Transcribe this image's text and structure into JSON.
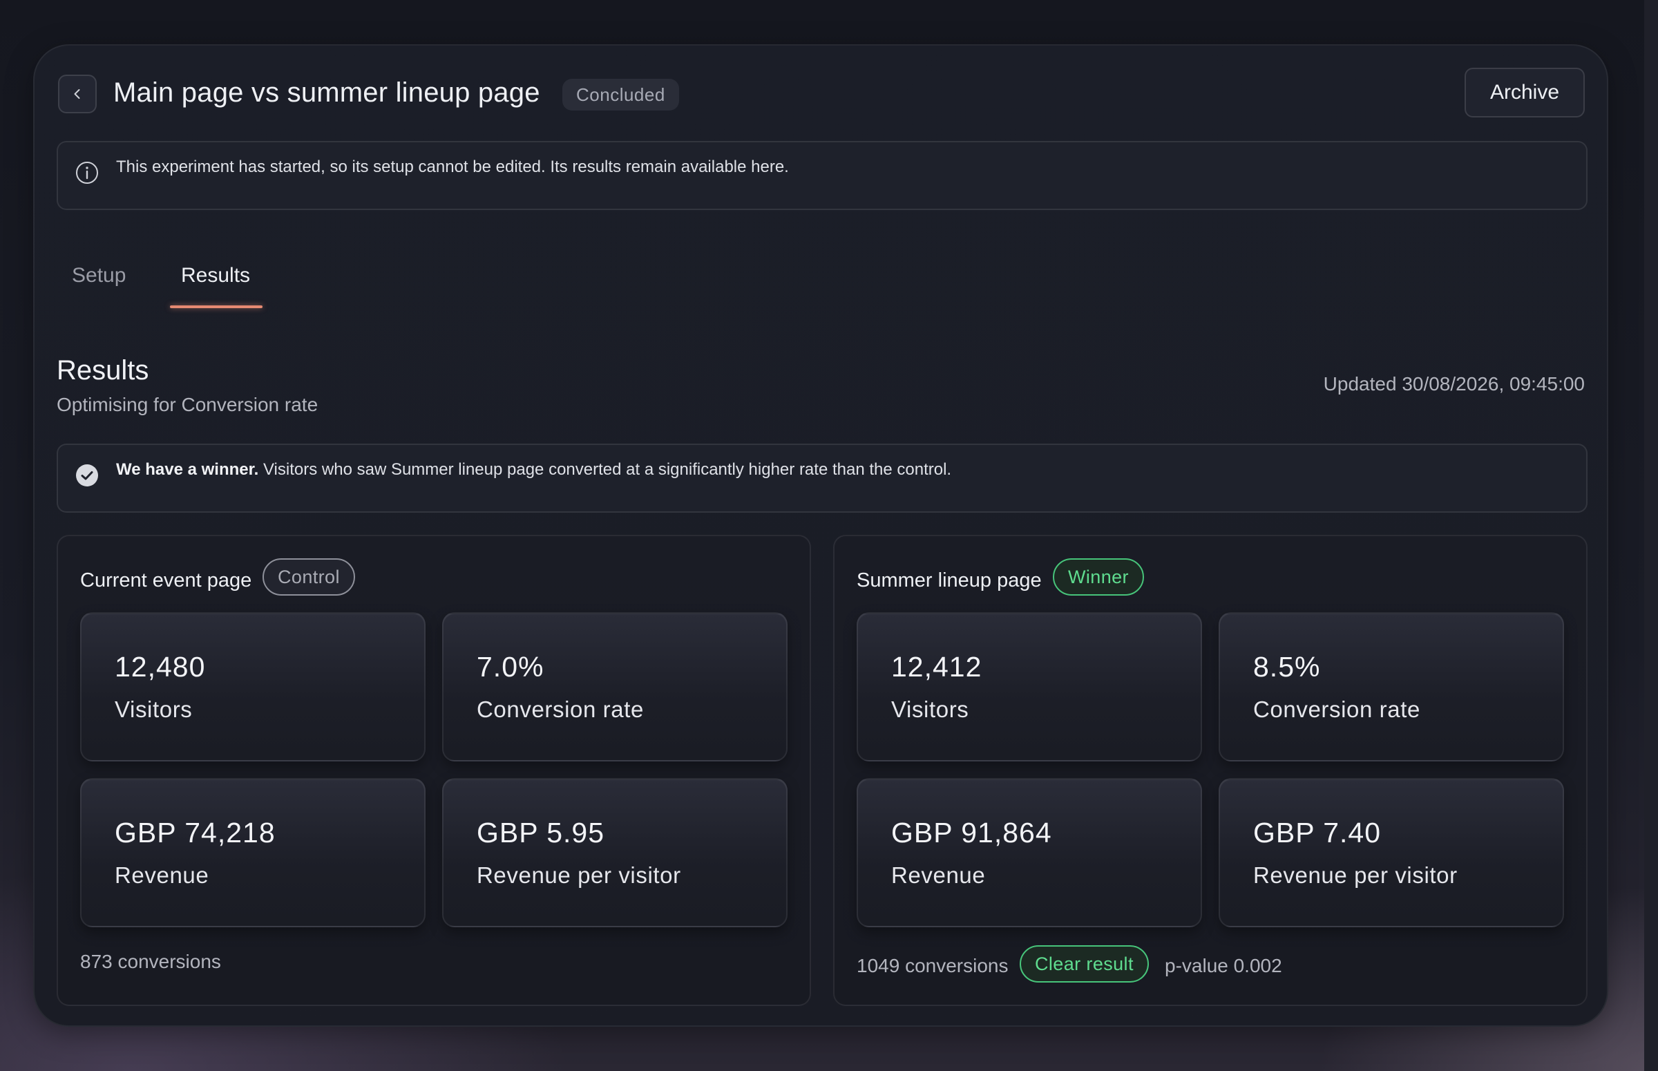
{
  "header": {
    "title": "Main page vs summer lineup page",
    "status": "Concluded",
    "archive_label": "Archive"
  },
  "info_banner": {
    "icon": "info-icon",
    "text": "This experiment has started, so its setup cannot be edited. Its results remain available here."
  },
  "tabs": [
    {
      "label": "Setup",
      "active": false
    },
    {
      "label": "Results",
      "active": true
    }
  ],
  "results": {
    "title": "Results",
    "subtitle": "Optimising for Conversion rate",
    "updated": "Updated 30/08/2026, 09:45:00"
  },
  "winner_banner": {
    "icon": "check-circle-icon",
    "bold": "We have a winner.",
    "text": " Visitors who saw Summer lineup page converted at a significantly higher rate than the control."
  },
  "variants": [
    {
      "name": "Current event page",
      "badge": "Control",
      "metrics": [
        {
          "value": "12,480",
          "label": "Visitors"
        },
        {
          "value": "7.0%",
          "label": "Conversion rate"
        },
        {
          "value": "GBP 74,218",
          "label": "Revenue"
        },
        {
          "value": "GBP 5.95",
          "label": "Revenue per visitor"
        }
      ],
      "conversions": "873 conversions"
    },
    {
      "name": "Summer lineup page",
      "badge": "Winner",
      "metrics": [
        {
          "value": "12,412",
          "label": "Visitors"
        },
        {
          "value": "8.5%",
          "label": "Conversion rate"
        },
        {
          "value": "GBP 91,864",
          "label": "Revenue"
        },
        {
          "value": "GBP 7.40",
          "label": "Revenue per visitor"
        }
      ],
      "conversions": "1049 conversions",
      "result_badge": "Clear result",
      "p_value": "p-value 0.002"
    }
  ],
  "colors": {
    "accent_tab": "#e58a72",
    "winner_green": "#5fdc8f"
  }
}
